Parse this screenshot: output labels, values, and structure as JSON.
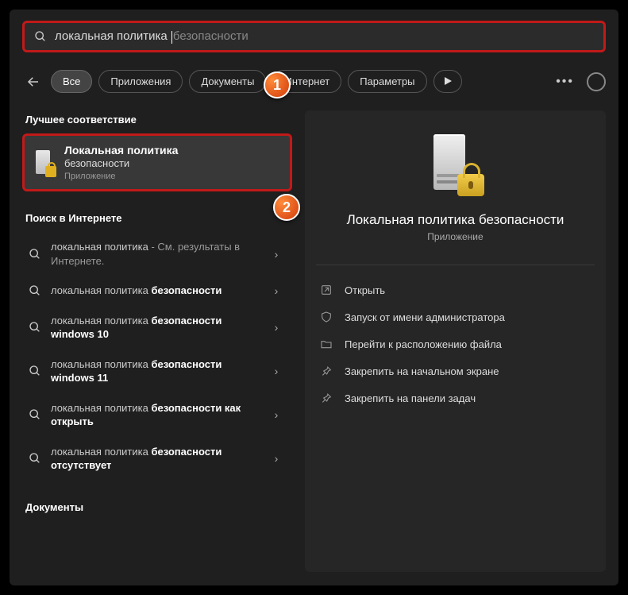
{
  "search": {
    "typed": "локальная политика ",
    "suggestion": "безопасности"
  },
  "filters": {
    "all": "Все",
    "apps": "Приложения",
    "docs": "Документы",
    "internet": "Интернет",
    "settings": "Параметры"
  },
  "sections": {
    "best_match": "Лучшее соответствие",
    "web": "Поиск в Интернете",
    "documents": "Документы"
  },
  "best_match": {
    "title": "Локальная политика",
    "subtitle": "безопасности",
    "type": "Приложение"
  },
  "web_results": [
    {
      "plain": "локальная политика",
      "bold": "",
      "tail": " - См. результаты в Интернете."
    },
    {
      "plain": "локальная политика ",
      "bold": "безопасности",
      "tail": ""
    },
    {
      "plain": "локальная политика ",
      "bold": "безопасности windows 10",
      "tail": ""
    },
    {
      "plain": "локальная политика ",
      "bold": "безопасности windows 11",
      "tail": ""
    },
    {
      "plain": "локальная политика ",
      "bold": "безопасности как открыть",
      "tail": ""
    },
    {
      "plain": "локальная политика ",
      "bold": "безопасности отсутствует",
      "tail": ""
    }
  ],
  "detail": {
    "title": "Локальная политика безопасности",
    "type": "Приложение",
    "actions": {
      "open": "Открыть",
      "admin": "Запуск от имени администратора",
      "location": "Перейти к расположению файла",
      "pin_start": "Закрепить на начальном экране",
      "pin_taskbar": "Закрепить на панели задач"
    }
  },
  "callouts": {
    "c1": "1",
    "c2": "2"
  }
}
